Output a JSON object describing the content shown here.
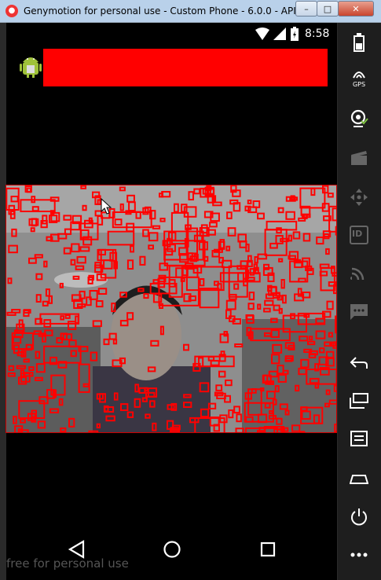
{
  "window": {
    "title": "Genymotion for personal use - Custom Phone - 6.0.0 - API 23 -...",
    "min_label": "–",
    "max_label": "□",
    "close_label": "✕"
  },
  "statusbar": {
    "time": "8:58"
  },
  "watermark": "free for personal use",
  "sidebar": {
    "gps_label": "GPS",
    "id_label": "ID"
  },
  "colors": {
    "detection": "#ff0000",
    "appbar_red": "#ff0000"
  }
}
